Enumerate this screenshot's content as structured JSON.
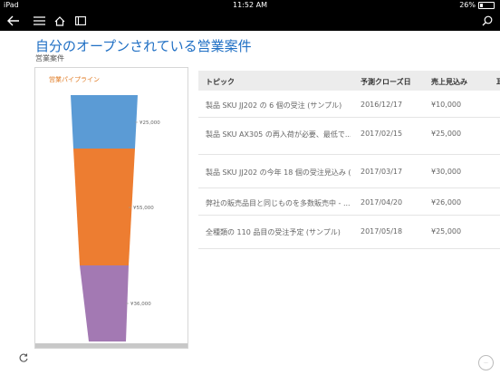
{
  "status_bar": {
    "device": "iPad",
    "time": "11:52 AM",
    "battery": "26%"
  },
  "icons": {
    "back": "back-arrow-icon",
    "menu": "hamburger-menu-icon",
    "home": "home-icon",
    "panel": "panel-icon",
    "search": "search-icon",
    "refresh": "refresh-icon"
  },
  "page": {
    "title": "自分のオープンされている営業案件",
    "subtitle": "営業案件"
  },
  "funnel": {
    "title": "営業パイプライン",
    "stages": [
      {
        "value_label": "¥25,000",
        "color": "#5b9bd5"
      },
      {
        "value_label": "¥55,000",
        "color": "#ed7d31"
      },
      {
        "value_label": "¥36,000",
        "color": "#a379b3"
      }
    ]
  },
  "table": {
    "columns": [
      "トピック",
      "予測クローズ日",
      "売上見込み",
      "耳"
    ],
    "rows": [
      {
        "topic": "製品 SKU JJ202 の 6 個の受注 (サンプル)",
        "date": "2016/12/17",
        "revenue": "¥10,000"
      },
      {
        "topic": "製品 SKU AX305 の再入荷が必要、最低で...",
        "date": "2017/02/15",
        "revenue": "¥25,000"
      },
      {
        "topic": "製品 SKU JJ202 の今年 18 個の受注見込み (...",
        "date": "2017/03/17",
        "revenue": "¥30,000"
      },
      {
        "topic": "弊社の販売品目と同じものを多数販売中 - ...",
        "date": "2017/04/20",
        "revenue": "¥26,000"
      },
      {
        "topic": "全種類の 110 品目の受注予定 (サンプル)",
        "date": "2017/05/18",
        "revenue": "¥25,000"
      }
    ]
  },
  "colors": {
    "accent": "#1f6fc4",
    "funnel_title": "#e07b24"
  }
}
